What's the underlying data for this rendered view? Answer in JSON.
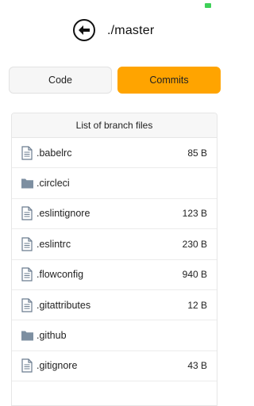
{
  "header": {
    "title": "./master"
  },
  "tabs": [
    {
      "label": "Code"
    },
    {
      "label": "Commits"
    }
  ],
  "files": {
    "heading": "List of branch files",
    "items": [
      {
        "name": ".babelrc",
        "size": "85 B",
        "type": "file"
      },
      {
        "name": ".circleci",
        "size": "",
        "type": "folder"
      },
      {
        "name": ".eslintignore",
        "size": "123 B",
        "type": "file"
      },
      {
        "name": ".eslintrc",
        "size": "230 B",
        "type": "file"
      },
      {
        "name": ".flowconfig",
        "size": "940 B",
        "type": "file"
      },
      {
        "name": ".gitattributes",
        "size": "12 B",
        "type": "file"
      },
      {
        "name": ".github",
        "size": "",
        "type": "folder"
      },
      {
        "name": ".gitignore",
        "size": "43 B",
        "type": "file"
      }
    ]
  },
  "colors": {
    "accent": "#ffa400",
    "battery": "#3ed158",
    "folder": "#7d8fa1"
  },
  "icons": {
    "back": "arrow-left-circle-icon",
    "file": "file-icon",
    "folder": "folder-icon"
  }
}
